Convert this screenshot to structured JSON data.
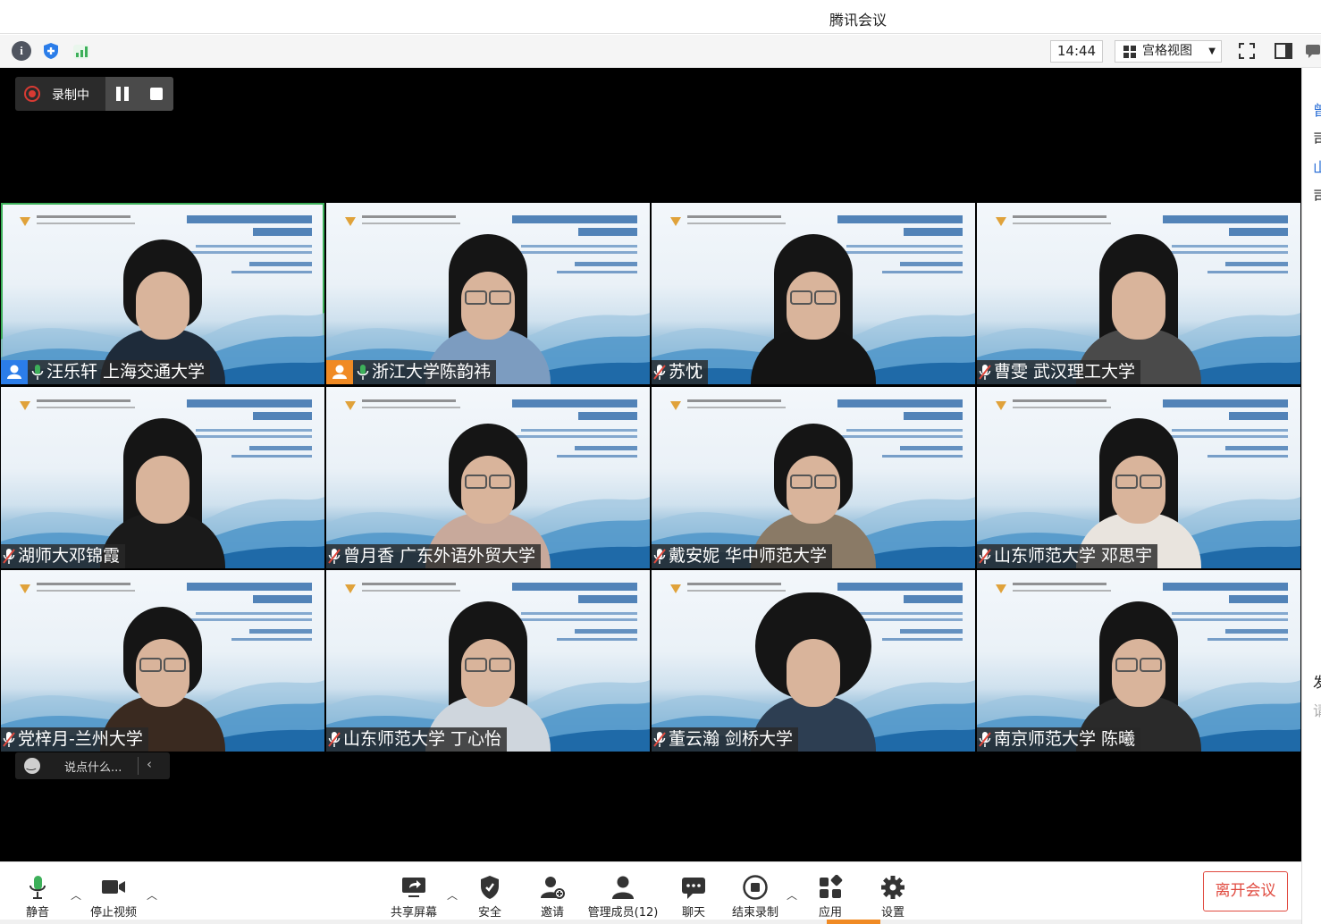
{
  "window": {
    "title": "腾讯会议"
  },
  "toolbar": {
    "time": "14:44",
    "view_mode": "宫格视图"
  },
  "recording": {
    "label": "录制中"
  },
  "participants": [
    {
      "name": "汪乐轩 上海交通大学",
      "mic": "on",
      "role": "host",
      "active": true,
      "hair": "short",
      "glasses": false,
      "shirt": "#1e2b3a"
    },
    {
      "name": "浙江大学陈韵祎",
      "mic": "on",
      "role": "cohost",
      "active": false,
      "hair": "long",
      "glasses": true,
      "shirt": "#7c9cc0"
    },
    {
      "name": "苏忱",
      "mic": "muted",
      "role": "",
      "active": false,
      "hair": "long",
      "glasses": true,
      "shirt": "#141414"
    },
    {
      "name": "曹雯 武汉理工大学",
      "mic": "muted",
      "role": "",
      "active": false,
      "hair": "long",
      "glasses": false,
      "shirt": "#4a4a4a"
    },
    {
      "name": "湖师大邓锦霞",
      "mic": "muted",
      "role": "",
      "active": false,
      "hair": "long",
      "glasses": false,
      "shirt": "#1a1a1a"
    },
    {
      "name": "曾月香 广东外语外贸大学",
      "mic": "muted",
      "role": "",
      "active": false,
      "hair": "short",
      "glasses": true,
      "shirt": "#c8a99b"
    },
    {
      "name": "戴安妮 华中师范大学",
      "mic": "muted",
      "role": "",
      "active": false,
      "hair": "short",
      "glasses": true,
      "shirt": "#8a7a66"
    },
    {
      "name": "山东师范大学 邓思宇",
      "mic": "muted",
      "role": "",
      "active": false,
      "hair": "long",
      "glasses": true,
      "shirt": "#e9e4de"
    },
    {
      "name": "党梓月-兰州大学",
      "mic": "muted",
      "role": "",
      "active": false,
      "hair": "short",
      "glasses": true,
      "shirt": "#3a2a20"
    },
    {
      "name": "山东师范大学 丁心怡",
      "mic": "muted",
      "role": "",
      "active": false,
      "hair": "long",
      "glasses": true,
      "shirt": "#cfd6dd"
    },
    {
      "name": "董云瀚 剑桥大学",
      "mic": "muted",
      "role": "",
      "active": false,
      "hair": "curly",
      "glasses": false,
      "shirt": "#2d3e52"
    },
    {
      "name": "南京师范大学 陈曦",
      "mic": "muted",
      "role": "",
      "active": false,
      "hair": "long",
      "glasses": true,
      "shirt": "#2a2a2a"
    }
  ],
  "chat": {
    "placeholder": "说点什么..."
  },
  "controls": {
    "mute": "静音",
    "stop_video": "停止视频",
    "share_screen": "共享屏幕",
    "security": "安全",
    "invite": "邀请",
    "manage_members": "管理成员(12)",
    "chat": "聊天",
    "end_recording": "结束录制",
    "apps": "应用",
    "settings": "设置",
    "leave": "离开会议"
  },
  "right_panel": {
    "fragments": [
      "曾",
      "司",
      "山",
      "司",
      "发",
      "请"
    ]
  },
  "colors": {
    "accent_green": "#3db05a",
    "leave_red": "#e04a3f",
    "rec_red": "#d83a33",
    "host_blue": "#2b7de9",
    "cohost_orange": "#f08a24"
  }
}
